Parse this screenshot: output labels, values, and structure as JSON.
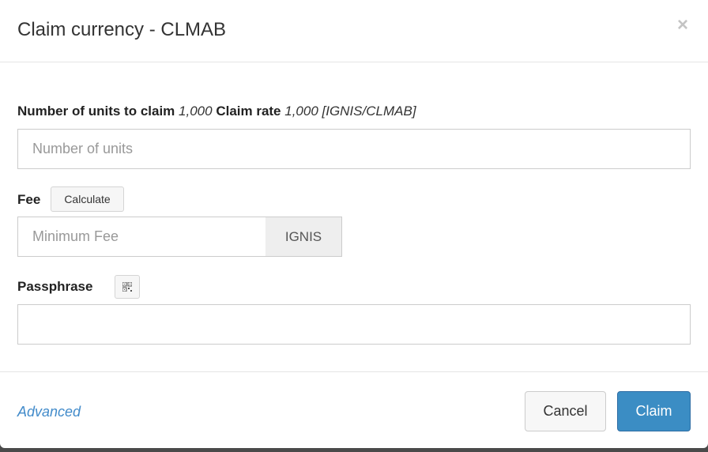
{
  "modal": {
    "title": "Claim currency - CLMAB",
    "close_symbol": "×"
  },
  "units": {
    "label": "Number of units to claim",
    "units_value": "1,000",
    "rate_label": "Claim rate",
    "rate_value": "1,000 [IGNIS/CLMAB]",
    "placeholder": "Number of units",
    "value": ""
  },
  "fee": {
    "label": "Fee",
    "calculate_label": "Calculate",
    "placeholder": "Minimum Fee",
    "value": "",
    "currency": "IGNIS"
  },
  "passphrase": {
    "label": "Passphrase",
    "icon": "qr-code-icon",
    "value": ""
  },
  "footer": {
    "advanced_label": "Advanced",
    "cancel_label": "Cancel",
    "claim_label": "Claim"
  },
  "colors": {
    "primary": "#3b8dc4",
    "link": "#428bca"
  }
}
